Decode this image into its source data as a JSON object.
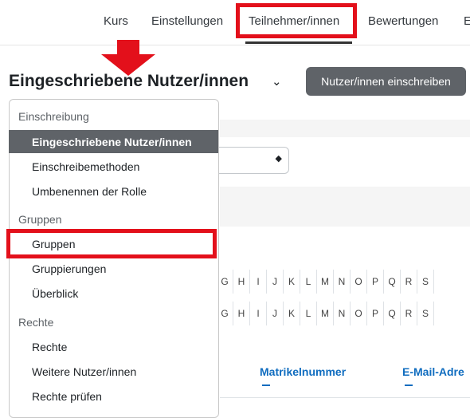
{
  "nav": {
    "items": [
      "Kurs",
      "Einstellungen",
      "Teilnehmer/innen",
      "Bewertungen",
      "E"
    ]
  },
  "header": {
    "title": "Eingeschriebene Nutzer/innen",
    "caret": "⌄",
    "enrol_button": "Nutzer/innen einschreiben"
  },
  "menu": {
    "section_enrol": "Einschreibung",
    "active_item": "Eingeschriebene Nutzer/innen",
    "enrol_methods": "Einschreibemethoden",
    "rename_role": "Umbenennen der Rolle",
    "section_groups": "Gruppen",
    "groups": "Gruppen",
    "groupings": "Gruppierungen",
    "overview": "Überblick",
    "section_rights": "Rechte",
    "rights": "Rechte",
    "other_users": "Weitere Nutzer/innen",
    "check_rights": "Rechte prüfen"
  },
  "filters": {
    "letters_row1": [
      "G",
      "H",
      "I",
      "J",
      "K",
      "L",
      "M",
      "N",
      "O",
      "P",
      "Q",
      "R",
      "S"
    ],
    "letters_row2": [
      "G",
      "H",
      "I",
      "J",
      "K",
      "L",
      "M",
      "N",
      "O",
      "P",
      "Q",
      "R",
      "S"
    ]
  },
  "table": {
    "col_matrikel": "Matrikelnummer",
    "col_email": "E-Mail-Adre"
  },
  "colors": {
    "highlight": "#e3101b",
    "button_bg": "#5f6368",
    "link": "#0f6cbf"
  }
}
